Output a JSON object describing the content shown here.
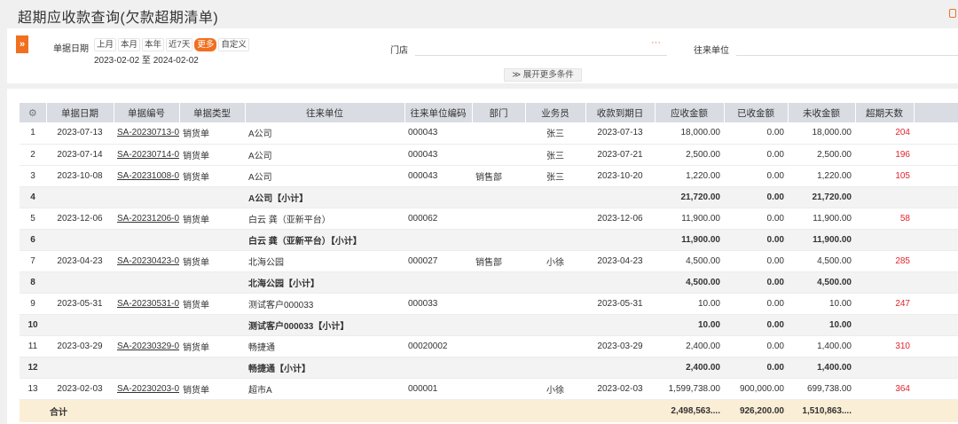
{
  "page": {
    "title": "超期应收款查询(欠款超期清单)"
  },
  "filters": {
    "expand_icon": "»",
    "date_label": "单据日期",
    "date_options": [
      "上月",
      "本月",
      "本年",
      "近7天",
      "更多",
      "自定义"
    ],
    "date_active_index": 4,
    "date_range": "2023-02-02 至 2024-02-02",
    "store_label": "门店",
    "store_more": "···",
    "partner_label": "往来单位",
    "more_conditions": "≫ 展开更多条件"
  },
  "table": {
    "headers": [
      "⚙",
      "单据日期",
      "单据编号",
      "单据类型",
      "往来单位",
      "往来单位编码",
      "部门",
      "业务员",
      "收款到期日",
      "应收金额",
      "已收金额",
      "未收金额",
      "超期天数"
    ],
    "rows": [
      {
        "type": "data",
        "no": "1",
        "date": "2023-07-13",
        "doc": "SA-20230713-0",
        "kind": "销货单",
        "partner": "A公司",
        "code": "000043",
        "dept": "",
        "staff": "张三",
        "due": "2023-07-13",
        "receivable": "18,000.00",
        "received": "0.00",
        "unpaid": "18,000.00",
        "overdue": "204"
      },
      {
        "type": "data",
        "no": "2",
        "date": "2023-07-14",
        "doc": "SA-20230714-0",
        "kind": "销货单",
        "partner": "A公司",
        "code": "000043",
        "dept": "",
        "staff": "张三",
        "due": "2023-07-21",
        "receivable": "2,500.00",
        "received": "0.00",
        "unpaid": "2,500.00",
        "overdue": "196"
      },
      {
        "type": "data",
        "no": "3",
        "date": "2023-10-08",
        "doc": "SA-20231008-0",
        "kind": "销货单",
        "partner": "A公司",
        "code": "000043",
        "dept": "销售部",
        "staff": "张三",
        "due": "2023-10-20",
        "receivable": "1,220.00",
        "received": "0.00",
        "unpaid": "1,220.00",
        "overdue": "105"
      },
      {
        "type": "subtotal",
        "no": "4",
        "date": "",
        "doc": "",
        "kind": "",
        "partner": "A公司【小计】",
        "code": "",
        "dept": "",
        "staff": "",
        "due": "",
        "receivable": "21,720.00",
        "received": "0.00",
        "unpaid": "21,720.00",
        "overdue": ""
      },
      {
        "type": "data",
        "no": "5",
        "date": "2023-12-06",
        "doc": "SA-20231206-0",
        "kind": "销货单",
        "partner": "白云 龚（亚新平台）",
        "code": "000062",
        "dept": "",
        "staff": "",
        "due": "2023-12-06",
        "receivable": "11,900.00",
        "received": "0.00",
        "unpaid": "11,900.00",
        "overdue": "58"
      },
      {
        "type": "subtotal",
        "no": "6",
        "date": "",
        "doc": "",
        "kind": "",
        "partner": "白云 龚（亚新平台）【小计】",
        "code": "",
        "dept": "",
        "staff": "",
        "due": "",
        "receivable": "11,900.00",
        "received": "0.00",
        "unpaid": "11,900.00",
        "overdue": ""
      },
      {
        "type": "data",
        "no": "7",
        "date": "2023-04-23",
        "doc": "SA-20230423-0",
        "kind": "销货单",
        "partner": "北海公园",
        "code": "000027",
        "dept": "销售部",
        "staff": "小徐",
        "due": "2023-04-23",
        "receivable": "4,500.00",
        "received": "0.00",
        "unpaid": "4,500.00",
        "overdue": "285"
      },
      {
        "type": "subtotal",
        "no": "8",
        "date": "",
        "doc": "",
        "kind": "",
        "partner": "北海公园【小计】",
        "code": "",
        "dept": "",
        "staff": "",
        "due": "",
        "receivable": "4,500.00",
        "received": "0.00",
        "unpaid": "4,500.00",
        "overdue": ""
      },
      {
        "type": "data",
        "no": "9",
        "date": "2023-05-31",
        "doc": "SA-20230531-0",
        "kind": "销货单",
        "partner": "测试客户000033",
        "code": "000033",
        "dept": "",
        "staff": "",
        "due": "2023-05-31",
        "receivable": "10.00",
        "received": "0.00",
        "unpaid": "10.00",
        "overdue": "247"
      },
      {
        "type": "subtotal",
        "no": "10",
        "date": "",
        "doc": "",
        "kind": "",
        "partner": "测试客户000033【小计】",
        "code": "",
        "dept": "",
        "staff": "",
        "due": "",
        "receivable": "10.00",
        "received": "0.00",
        "unpaid": "10.00",
        "overdue": ""
      },
      {
        "type": "data",
        "no": "11",
        "date": "2023-03-29",
        "doc": "SA-20230329-0",
        "kind": "销货单",
        "partner": "畅捷通",
        "code": "00020002",
        "dept": "",
        "staff": "",
        "due": "2023-03-29",
        "receivable": "2,400.00",
        "received": "0.00",
        "unpaid": "1,400.00",
        "overdue": "310"
      },
      {
        "type": "subtotal",
        "no": "12",
        "date": "",
        "doc": "",
        "kind": "",
        "partner": "畅捷通【小计】",
        "code": "",
        "dept": "",
        "staff": "",
        "due": "",
        "receivable": "2,400.00",
        "received": "0.00",
        "unpaid": "1,400.00",
        "overdue": ""
      },
      {
        "type": "data",
        "no": "13",
        "date": "2023-02-03",
        "doc": "SA-20230203-0",
        "kind": "销货单",
        "partner": "超市A",
        "code": "000001",
        "dept": "",
        "staff": "小徐",
        "due": "2023-02-03",
        "receivable": "1,599,738.00",
        "received": "900,000.00",
        "unpaid": "699,738.00",
        "overdue": "364"
      }
    ],
    "total": {
      "label": "合计",
      "receivable": "2,498,563....",
      "received": "926,200.00",
      "unpaid": "1,510,863...."
    }
  }
}
